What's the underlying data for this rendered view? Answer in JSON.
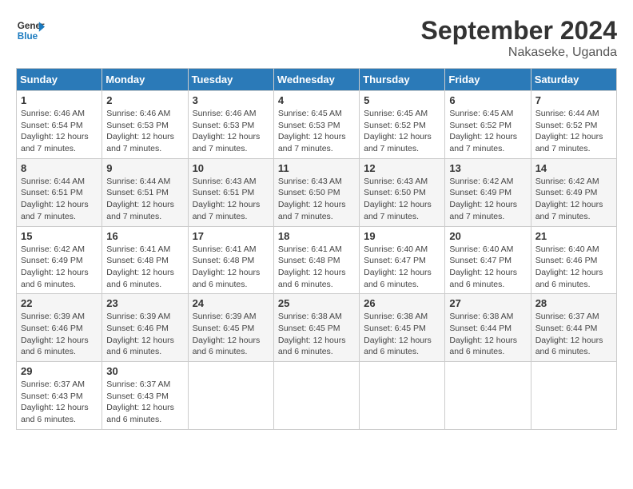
{
  "header": {
    "logo_line1": "General",
    "logo_line2": "Blue",
    "month": "September 2024",
    "location": "Nakaseke, Uganda"
  },
  "days_of_week": [
    "Sunday",
    "Monday",
    "Tuesday",
    "Wednesday",
    "Thursday",
    "Friday",
    "Saturday"
  ],
  "weeks": [
    [
      {
        "day": "1",
        "sunrise": "6:46 AM",
        "sunset": "6:54 PM",
        "daylight": "12 hours and 7 minutes."
      },
      {
        "day": "2",
        "sunrise": "6:46 AM",
        "sunset": "6:53 PM",
        "daylight": "12 hours and 7 minutes."
      },
      {
        "day": "3",
        "sunrise": "6:46 AM",
        "sunset": "6:53 PM",
        "daylight": "12 hours and 7 minutes."
      },
      {
        "day": "4",
        "sunrise": "6:45 AM",
        "sunset": "6:53 PM",
        "daylight": "12 hours and 7 minutes."
      },
      {
        "day": "5",
        "sunrise": "6:45 AM",
        "sunset": "6:52 PM",
        "daylight": "12 hours and 7 minutes."
      },
      {
        "day": "6",
        "sunrise": "6:45 AM",
        "sunset": "6:52 PM",
        "daylight": "12 hours and 7 minutes."
      },
      {
        "day": "7",
        "sunrise": "6:44 AM",
        "sunset": "6:52 PM",
        "daylight": "12 hours and 7 minutes."
      }
    ],
    [
      {
        "day": "8",
        "sunrise": "6:44 AM",
        "sunset": "6:51 PM",
        "daylight": "12 hours and 7 minutes."
      },
      {
        "day": "9",
        "sunrise": "6:44 AM",
        "sunset": "6:51 PM",
        "daylight": "12 hours and 7 minutes."
      },
      {
        "day": "10",
        "sunrise": "6:43 AM",
        "sunset": "6:51 PM",
        "daylight": "12 hours and 7 minutes."
      },
      {
        "day": "11",
        "sunrise": "6:43 AM",
        "sunset": "6:50 PM",
        "daylight": "12 hours and 7 minutes."
      },
      {
        "day": "12",
        "sunrise": "6:43 AM",
        "sunset": "6:50 PM",
        "daylight": "12 hours and 7 minutes."
      },
      {
        "day": "13",
        "sunrise": "6:42 AM",
        "sunset": "6:49 PM",
        "daylight": "12 hours and 7 minutes."
      },
      {
        "day": "14",
        "sunrise": "6:42 AM",
        "sunset": "6:49 PM",
        "daylight": "12 hours and 7 minutes."
      }
    ],
    [
      {
        "day": "15",
        "sunrise": "6:42 AM",
        "sunset": "6:49 PM",
        "daylight": "12 hours and 6 minutes."
      },
      {
        "day": "16",
        "sunrise": "6:41 AM",
        "sunset": "6:48 PM",
        "daylight": "12 hours and 6 minutes."
      },
      {
        "day": "17",
        "sunrise": "6:41 AM",
        "sunset": "6:48 PM",
        "daylight": "12 hours and 6 minutes."
      },
      {
        "day": "18",
        "sunrise": "6:41 AM",
        "sunset": "6:48 PM",
        "daylight": "12 hours and 6 minutes."
      },
      {
        "day": "19",
        "sunrise": "6:40 AM",
        "sunset": "6:47 PM",
        "daylight": "12 hours and 6 minutes."
      },
      {
        "day": "20",
        "sunrise": "6:40 AM",
        "sunset": "6:47 PM",
        "daylight": "12 hours and 6 minutes."
      },
      {
        "day": "21",
        "sunrise": "6:40 AM",
        "sunset": "6:46 PM",
        "daylight": "12 hours and 6 minutes."
      }
    ],
    [
      {
        "day": "22",
        "sunrise": "6:39 AM",
        "sunset": "6:46 PM",
        "daylight": "12 hours and 6 minutes."
      },
      {
        "day": "23",
        "sunrise": "6:39 AM",
        "sunset": "6:46 PM",
        "daylight": "12 hours and 6 minutes."
      },
      {
        "day": "24",
        "sunrise": "6:39 AM",
        "sunset": "6:45 PM",
        "daylight": "12 hours and 6 minutes."
      },
      {
        "day": "25",
        "sunrise": "6:38 AM",
        "sunset": "6:45 PM",
        "daylight": "12 hours and 6 minutes."
      },
      {
        "day": "26",
        "sunrise": "6:38 AM",
        "sunset": "6:45 PM",
        "daylight": "12 hours and 6 minutes."
      },
      {
        "day": "27",
        "sunrise": "6:38 AM",
        "sunset": "6:44 PM",
        "daylight": "12 hours and 6 minutes."
      },
      {
        "day": "28",
        "sunrise": "6:37 AM",
        "sunset": "6:44 PM",
        "daylight": "12 hours and 6 minutes."
      }
    ],
    [
      {
        "day": "29",
        "sunrise": "6:37 AM",
        "sunset": "6:43 PM",
        "daylight": "12 hours and 6 minutes."
      },
      {
        "day": "30",
        "sunrise": "6:37 AM",
        "sunset": "6:43 PM",
        "daylight": "12 hours and 6 minutes."
      },
      null,
      null,
      null,
      null,
      null
    ]
  ],
  "labels": {
    "sunrise": "Sunrise:",
    "sunset": "Sunset:",
    "daylight": "Daylight:"
  }
}
